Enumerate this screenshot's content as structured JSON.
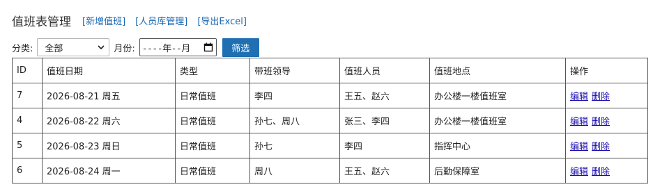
{
  "header": {
    "title": "值班表管理",
    "links": [
      "[新增值班]",
      "[人员库管理]",
      "[导出Excel]"
    ]
  },
  "filter": {
    "category_label": "分类:",
    "category_value": "全部",
    "month_label": "月份:",
    "month_placeholder": "----年--月",
    "button_label": "筛选"
  },
  "table": {
    "columns": [
      "ID",
      "值班日期",
      "类型",
      "带班领导",
      "值班人员",
      "值班地点",
      "操作"
    ],
    "rows": [
      {
        "id": "7",
        "date": "2026-08-21 周五",
        "type": "日常值班",
        "leader": "李四",
        "staff": "王五、赵六",
        "location": "办公楼一楼值班室",
        "edit": "编辑",
        "delete": "删除"
      },
      {
        "id": "4",
        "date": "2026-08-22 周六",
        "type": "日常值班",
        "leader": "孙七、周八",
        "staff": "张三、李四",
        "location": "办公楼一楼值班室",
        "edit": "编辑",
        "delete": "删除"
      },
      {
        "id": "5",
        "date": "2026-08-23 周日",
        "type": "日常值班",
        "leader": "孙七",
        "staff": "李四",
        "location": "指挥中心",
        "edit": "编辑",
        "delete": "删除"
      },
      {
        "id": "6",
        "date": "2026-08-24 周一",
        "type": "日常值班",
        "leader": "周八",
        "staff": "王五、赵六",
        "location": "后勤保障室",
        "edit": "编辑",
        "delete": "删除"
      }
    ]
  },
  "colors": {
    "link": "#1a67b1",
    "action_link": "#1a0dab",
    "button_bg": "#1f6fb2",
    "border": "#555555"
  }
}
